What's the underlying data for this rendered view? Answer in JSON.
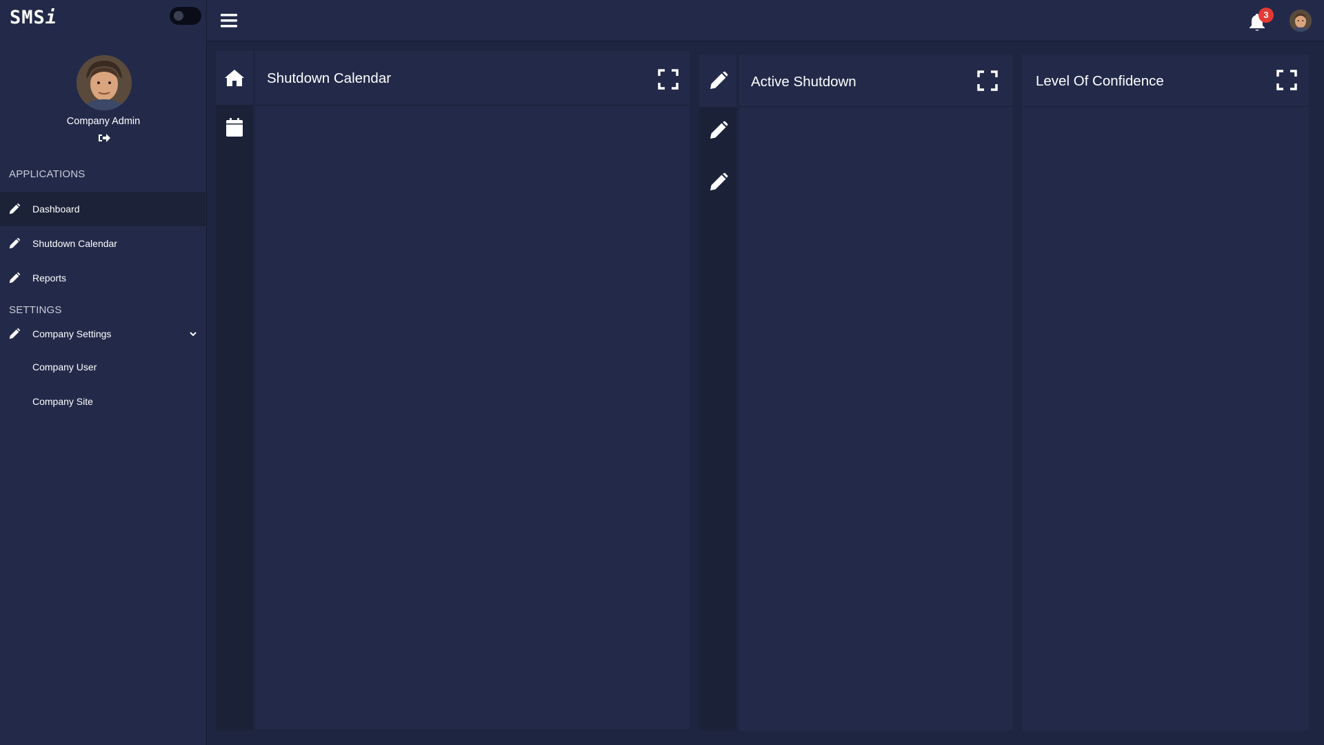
{
  "app": {
    "brand": "SMS",
    "brand_suffix": "i",
    "theme_toggle": "dark"
  },
  "sidebar": {
    "profile_name": "Company Admin",
    "sections": {
      "applications": "APPLICATIONS",
      "settings": "SETTINGS"
    },
    "items": [
      {
        "label": "Dashboard",
        "icon": "pencil-icon",
        "active": true
      },
      {
        "label": "Shutdown Calendar",
        "icon": "pencil-icon"
      },
      {
        "label": "Reports",
        "icon": "pencil-icon"
      },
      {
        "label": "Company Settings",
        "icon": "pencil-icon",
        "expanded": true
      },
      {
        "label": "Company User"
      },
      {
        "label": "Company Site"
      }
    ]
  },
  "topbar": {
    "notification_count": "3"
  },
  "panels": [
    {
      "title": "Shutdown Calendar"
    },
    {
      "title": "Active Shutdown"
    },
    {
      "title": "Level Of Confidence"
    }
  ],
  "colors": {
    "background": "#1e2540",
    "sidebar": "#232a49",
    "panel": "#232a49",
    "rail": "#1b2137",
    "badge": "#e53935"
  }
}
